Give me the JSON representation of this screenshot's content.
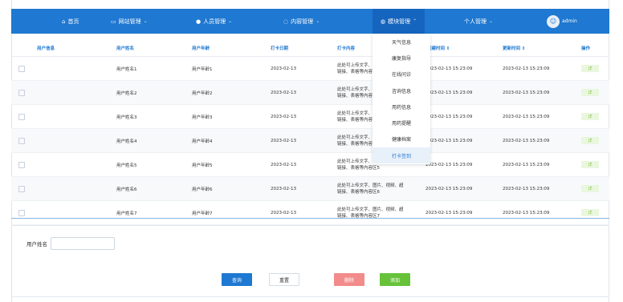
{
  "nav": {
    "home": {
      "icon": "home-icon",
      "label": "首页"
    },
    "items": [
      {
        "icon": "monitor-icon",
        "label": "网站管理",
        "chev": "⌄"
      },
      {
        "icon": "user-icon",
        "label": "人员管理",
        "chev": "⌄"
      },
      {
        "icon": "chat-icon",
        "label": "内容管理",
        "chev": "⌄"
      },
      {
        "icon": "module-icon",
        "label": "模块管理",
        "chev": "⌃"
      },
      {
        "icon": "",
        "label": "个人管理",
        "chev": "⌄"
      }
    ],
    "user": {
      "avatar": "avatar-icon",
      "name": "admin"
    }
  },
  "dropdown": {
    "items": [
      "天气信息",
      "康复指导",
      "在线问诊",
      "咨询信息",
      "用药信息",
      "用药提醒",
      "健康档案",
      "打卡签到"
    ],
    "active_index": 7
  },
  "table": {
    "headers": [
      "用户信息",
      "用户姓名",
      "用户年龄",
      "打卡日期",
      "打卡内容",
      "创建时间 ⇕",
      "更新时间 ⇕",
      "操作"
    ],
    "rows": [
      {
        "name": "用户姓名1",
        "age": "用户年龄1",
        "date": "2023-02-13",
        "content_a": "此处可上传文字、图片、视频、超",
        "content_b": "链接、表格等内容区1",
        "created": "2023-02-13 15:23:09",
        "updated": "2023-02-13 15:23:09",
        "op": "详"
      },
      {
        "name": "用户姓名2",
        "age": "用户年龄2",
        "date": "2023-02-13",
        "content_a": "此处可上传文字、图片、视频、超",
        "content_b": "链接、表格等内容区2",
        "created": "2023-02-13 15:23:09",
        "updated": "2023-02-13 15:23:09",
        "op": "详"
      },
      {
        "name": "用户姓名3",
        "age": "用户年龄3",
        "date": "2023-02-13",
        "content_a": "此处可上传文字、图片、视频、超",
        "content_b": "链接、表格等内容区3",
        "created": "2023-02-13 15:23:09",
        "updated": "2023-02-13 15:23:09",
        "op": "详"
      },
      {
        "name": "用户姓名4",
        "age": "用户年龄4",
        "date": "2023-02-13",
        "content_a": "此处可上传文字、图片、视频、超",
        "content_b": "链接、表格等内容区4",
        "created": "2023-02-13 15:23:09",
        "updated": "2023-02-13 15:23:09",
        "op": "详"
      },
      {
        "name": "用户姓名5",
        "age": "用户年龄5",
        "date": "2023-02-13",
        "content_a": "此处可上传文字、图片、视频、超",
        "content_b": "链接、表格等内容区5",
        "created": "2023-02-13 15:23:09",
        "updated": "2023-02-13 15:23:09",
        "op": "详"
      },
      {
        "name": "用户姓名6",
        "age": "用户年龄6",
        "date": "2023-02-13",
        "content_a": "此处可上传文字、图片、视频、超",
        "content_b": "链接、表格等内容区6",
        "created": "2023-02-13 15:23:09",
        "updated": "2023-02-13 15:23:09",
        "op": "详"
      },
      {
        "name": "用户姓名7",
        "age": "用户年龄7",
        "date": "2023-02-13",
        "content_a": "此处可上传文字、图片、视频、超",
        "content_b": "链接、表格等内容区7",
        "created": "2023-02-13 15:23:09",
        "updated": "2023-02-13 15:23:09",
        "op": "详"
      }
    ]
  },
  "search": {
    "label": "用户姓名",
    "value": "",
    "placeholder": ""
  },
  "actions": {
    "query": "查询",
    "reset": "重置",
    "delete": "删除",
    "add": "添加"
  },
  "colors": {
    "primary": "#1f78d1",
    "danger": "#f28b8b",
    "success": "#67c23a"
  }
}
